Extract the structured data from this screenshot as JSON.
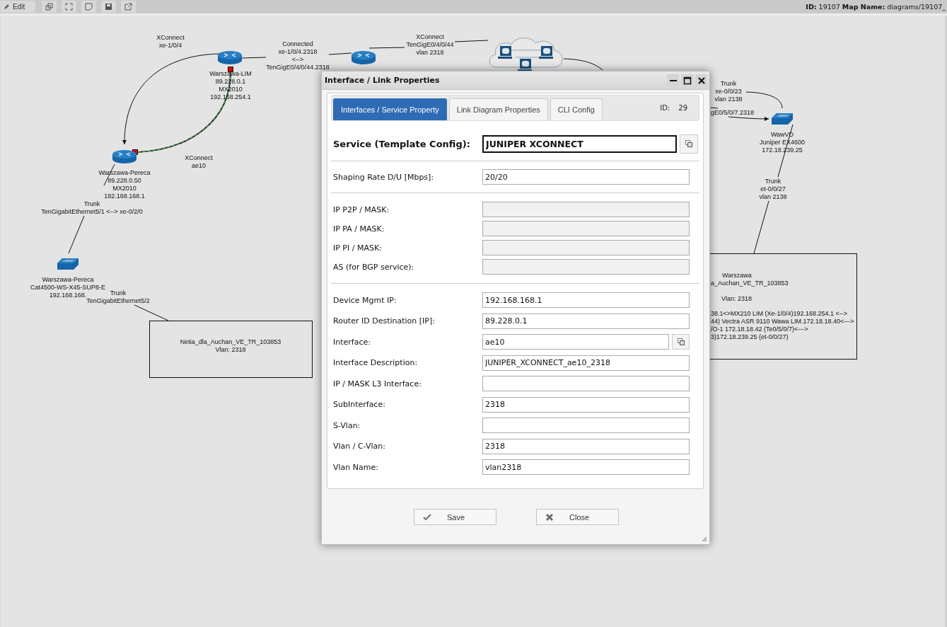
{
  "toolbar": {
    "edit_button": "Edit",
    "map_info": "**ID:** 19107 **Map Name:** diagrams/19107_"
  },
  "diagram": {
    "nodes": [
      {
        "kind": "router"
      },
      {
        "kind": "router"
      },
      {
        "kind": "router"
      },
      {
        "kind": "switch"
      },
      {
        "kind": "switch"
      },
      {
        "kind": "cloud"
      }
    ],
    "labels": [
      {
        "lines": [
          "XConnect",
          "xe-1/0/4"
        ]
      },
      {
        "lines": [
          "Warszawa-LIM",
          "89.228.0.1",
          "MX2010",
          "192.168.254.1"
        ]
      },
      {
        "lines": [
          "Connected",
          "xe-1/0/4.2318",
          "<-->",
          "TenGigE0/4/0/44.2318"
        ]
      },
      {
        "lines": [
          "XConnect",
          "TenGigE0/4/0/44",
          "vlan 2318"
        ]
      },
      {
        "lines": [
          "Warszawa-Pereca",
          "89.228.0.50",
          "MX2010",
          "192.168.168.1"
        ]
      },
      {
        "lines": [
          "XConnect",
          "ae10"
        ]
      },
      {
        "lines": [
          "Trunk",
          "TenGigabitEthernet5/1 <--> xe-0/2/0"
        ]
      },
      {
        "lines": [
          "Warszawa-Pereca",
          "Cat4500-WS-X45-SUP8-E",
          "192.168.168."
        ]
      },
      {
        "lines": [
          "Trunk",
          "TenGigabitEthernet5/2"
        ]
      },
      {
        "lines": [
          "Trunk",
          "xe-0/0/23",
          "vlan 2138"
        ]
      },
      {
        "lines": [
          "gE0/5/0/7.2318"
        ]
      },
      {
        "lines": [
          "WawVD",
          "Juniper EX4600",
          "172.18.239.25"
        ]
      },
      {
        "lines": [
          "Trunk",
          "et-0/0/27",
          "vlan 2138"
        ]
      }
    ],
    "notes": [
      {
        "lines": [
          "Netia_dla_Auchan_VE_TR_103853",
          "Vlan: 2318"
        ]
      },
      {
        "lines": [
          "Warszawa",
          "a_Auchan_VE_TR_103853",
          "Vlan: 2318",
          "38.1<>MX210 LIM (Xe-1/0/4)192.168.254.1 <-->",
          "44) Vectra ASR 9110 Wawa LIM.172.18.18.40<--->",
          "/O-1 172.18.18.42 (Te0/5/0/7)<--->",
          "3)172.18.239.25 (et-0/0/27)"
        ]
      }
    ]
  },
  "dialog": {
    "title": "Interface / Link Properties",
    "tabs": [
      {
        "label": "Interfaces / Service Property",
        "selected": true
      },
      {
        "label": "Link Diagram Properties",
        "selected": false
      },
      {
        "label": "CLI Config",
        "selected": false
      }
    ],
    "id_label": "ID:",
    "id_value": "29",
    "service": {
      "label": "Service (Template Config):",
      "value": "JUNIPER XCONNECT"
    },
    "sections": [
      [
        {
          "label": "Shaping Rate D/U [Mbps]:",
          "value": "20/20",
          "disabled": false,
          "kind": "plain"
        }
      ],
      [
        {
          "label": "IP P2P / MASK:",
          "disabled": true,
          "kind": "plain"
        },
        {
          "label": "IP PA / MASK:",
          "disabled": true,
          "kind": "plain"
        },
        {
          "label": "IP PI / MASK:",
          "disabled": true,
          "kind": "plain"
        },
        {
          "label": "AS (for BGP service):",
          "disabled": true,
          "kind": "plain"
        }
      ],
      [
        {
          "label": "Device Mgmt IP:",
          "value": "192.168.168.1",
          "disabled": false,
          "kind": "plain"
        },
        {
          "label": "Router ID Destination [IP]:",
          "value": "89.228.0.1",
          "disabled": false,
          "kind": "plain"
        },
        {
          "label": "Interface:",
          "value": "ae10",
          "disabled": false,
          "kind": "with-button"
        },
        {
          "label": "Interface Description:",
          "value": "JUNIPER_XCONNECT_ae10_2318",
          "disabled": false,
          "kind": "plain"
        },
        {
          "label": "IP / MASK L3 Interface:",
          "disabled": false,
          "kind": "plain"
        },
        {
          "label": "SubInterface:",
          "value": "2318",
          "disabled": false,
          "kind": "plain"
        },
        {
          "label": "S-Vlan:",
          "disabled": false,
          "kind": "plain"
        },
        {
          "label": "Vlan / C-Vlan:",
          "value": "2318",
          "disabled": false,
          "kind": "plain"
        },
        {
          "label": "Vlan Name:",
          "value": "vlan2318",
          "disabled": false,
          "kind": "plain"
        }
      ]
    ],
    "buttons": [
      {
        "kind": "save",
        "label": "Save"
      },
      {
        "kind": "close",
        "label": "Close"
      }
    ]
  }
}
